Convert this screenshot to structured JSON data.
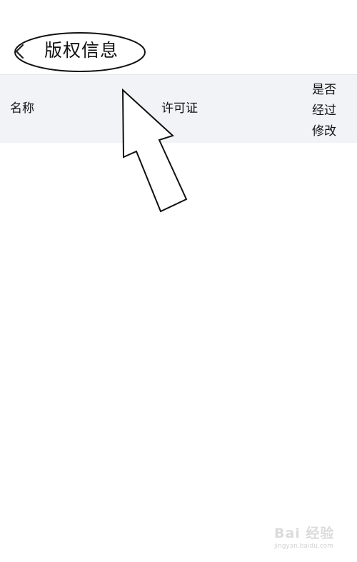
{
  "nav": {
    "title": "版权信息",
    "back_icon": "chevron-left-icon"
  },
  "table": {
    "columns": [
      "名称",
      "许可证",
      "是否经过修改"
    ],
    "rows": []
  },
  "annotation": {
    "shape": "ellipse-around-title",
    "arrow": "arrow-pointing-up-left",
    "stroke_color": "#111111"
  },
  "watermark": {
    "text": "Bai 经验",
    "url": "jingyan.baidu.com"
  },
  "colors": {
    "header_bg": "#f2f3f7",
    "page_bg": "#ffffff",
    "text": "#111111"
  }
}
